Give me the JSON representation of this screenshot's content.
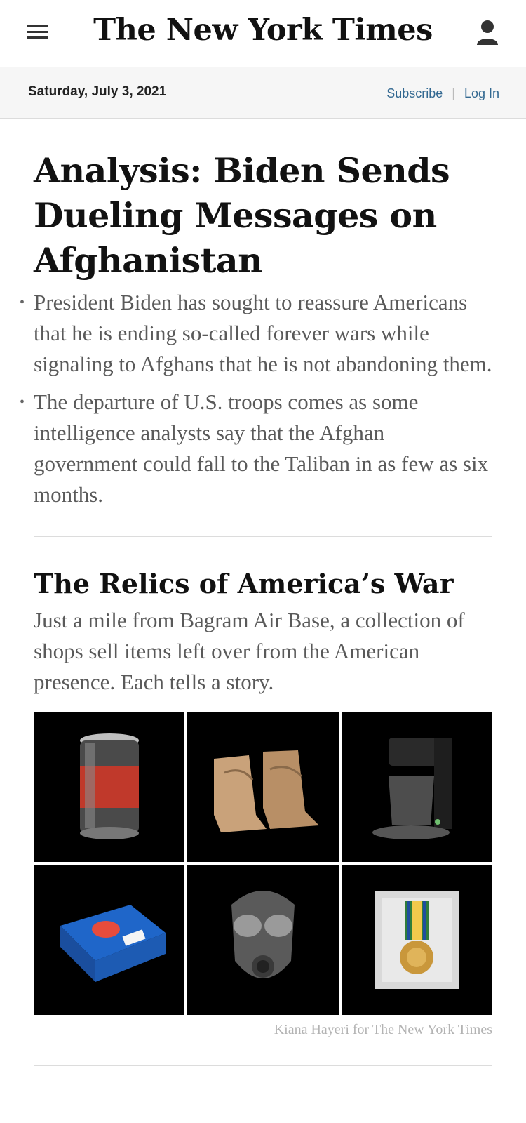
{
  "header": {
    "masthead": "The New York Times",
    "menu_icon": "hamburger-menu-icon",
    "account_icon": "user-account-icon"
  },
  "datebar": {
    "date": "Saturday, July 3, 2021",
    "subscribe": "Subscribe",
    "separator": "|",
    "login": "Log In"
  },
  "article": {
    "headline": "Analysis: Biden Sends Dueling Messages on Afghanistan",
    "summary": [
      "President Biden has sought to reassure Americans that he is ending so-called forever wars while signaling to Afghans that he is not abandoning them.",
      "The departure of U.S. troops comes as some intelligence analysts say that the Afghan government could fall to the Taliban in as few as six months."
    ]
  },
  "feature": {
    "title": "The Relics of America’s War",
    "dek": "Just a mile from Bagram Air Base, a collection of shops sell items left over from the American presence. Each tells a story.",
    "photos": [
      "soda-can",
      "combat-boots",
      "coffee-maker",
      "pop-tarts-box",
      "gas-mask",
      "service-medal"
    ],
    "credit": "Kiana Hayeri for The New York Times"
  },
  "colors": {
    "link": "#326891",
    "summary_text": "#5a5a5a",
    "datebar_bg": "#f6f6f6"
  }
}
